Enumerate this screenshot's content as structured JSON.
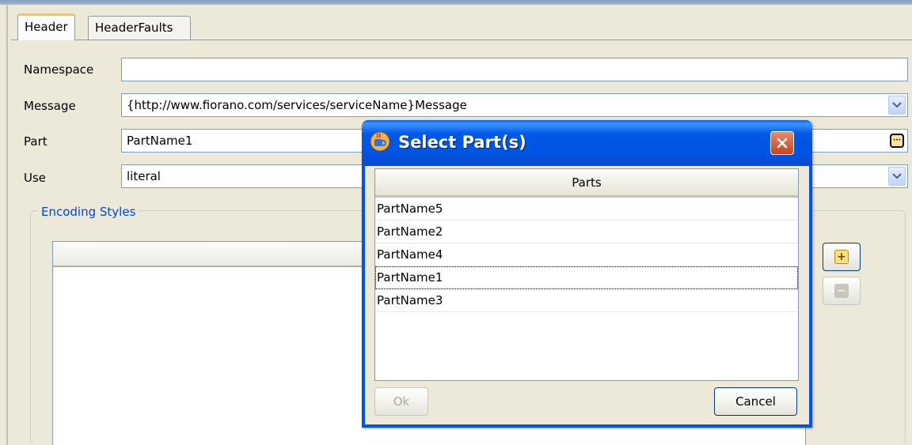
{
  "tabs": [
    {
      "label": "Header",
      "active": true
    },
    {
      "label": "HeaderFaults",
      "active": false
    }
  ],
  "form": {
    "namespace": {
      "label": "Namespace",
      "value": ""
    },
    "message": {
      "label": "Message",
      "value": "{http://www.fiorano.com/services/serviceName}Message"
    },
    "part": {
      "label": "Part",
      "value": "PartName1"
    },
    "use": {
      "label": "Use",
      "value": "literal"
    }
  },
  "encoding": {
    "title": "Encoding Styles",
    "add_icon": "plus-icon",
    "remove_icon": "minus-icon"
  },
  "dialog": {
    "title": "Select Part(s)",
    "column_header": "Parts",
    "rows": [
      "PartName5",
      "PartName2",
      "PartName4",
      "PartName1",
      "PartName3"
    ],
    "focused_row": "PartName1",
    "ok_label": "Ok",
    "cancel_label": "Cancel",
    "icon": "java-cup-icon",
    "close_icon": "close-icon"
  },
  "colors": {
    "titlebar": "#0054e3",
    "accent_tab": "#ffc83c",
    "group_title": "#0046d5",
    "close_button": "#d9582f"
  }
}
